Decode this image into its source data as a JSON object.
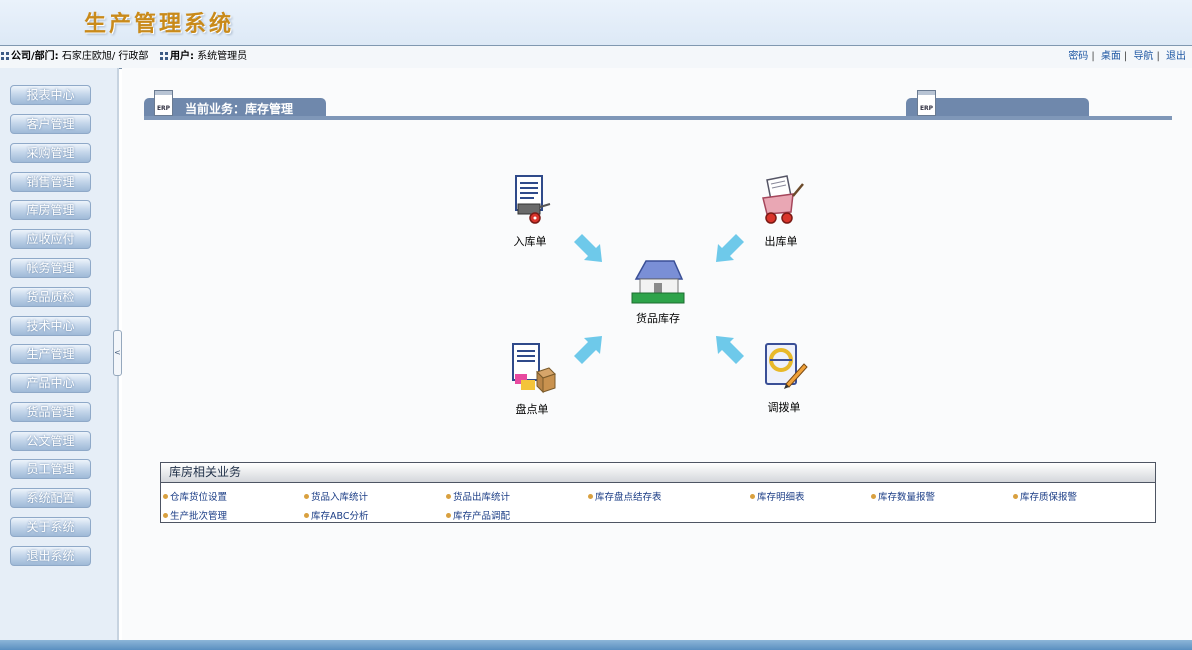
{
  "header": {
    "app_title": "生产管理系统"
  },
  "infobar": {
    "company_label": "公司/部门:",
    "company_value": "石家庄欧旭/ 行政部",
    "user_label": "用户:",
    "user_value": "系统管理员",
    "links": [
      "密码",
      "桌面",
      "导航",
      "退出"
    ]
  },
  "sidebar": {
    "items": [
      "报表中心",
      "客户管理",
      "采购管理",
      "销售管理",
      "库房管理",
      "应收应付",
      "帐务管理",
      "货品质检",
      "技术中心",
      "生产管理",
      "产品中心",
      "货品管理",
      "公文管理",
      "员工管理",
      "系统配置",
      "关于系统",
      "退出系统"
    ],
    "collapse_glyph": "<"
  },
  "business": {
    "badge": "ERP",
    "title": "当前业务：库存管理"
  },
  "flow": {
    "inbound": "入库单",
    "outbound": "出库单",
    "center": "货品库存",
    "stocktake": "盘点单",
    "transfer": "调拨单"
  },
  "panel": {
    "title": "库房相关业务",
    "links": [
      "仓库货位设置",
      "货品入库统计",
      "货品出库统计",
      "库存盘点结存表",
      "库存明细表",
      "库存数量报警",
      "库存质保报警",
      "生产批次管理",
      "库存ABC分析",
      "库存产品调配"
    ]
  },
  "colors": {
    "accent": "#6f88ac",
    "title_gold": "#c98a1a",
    "arrow": "#6ec9ea"
  }
}
